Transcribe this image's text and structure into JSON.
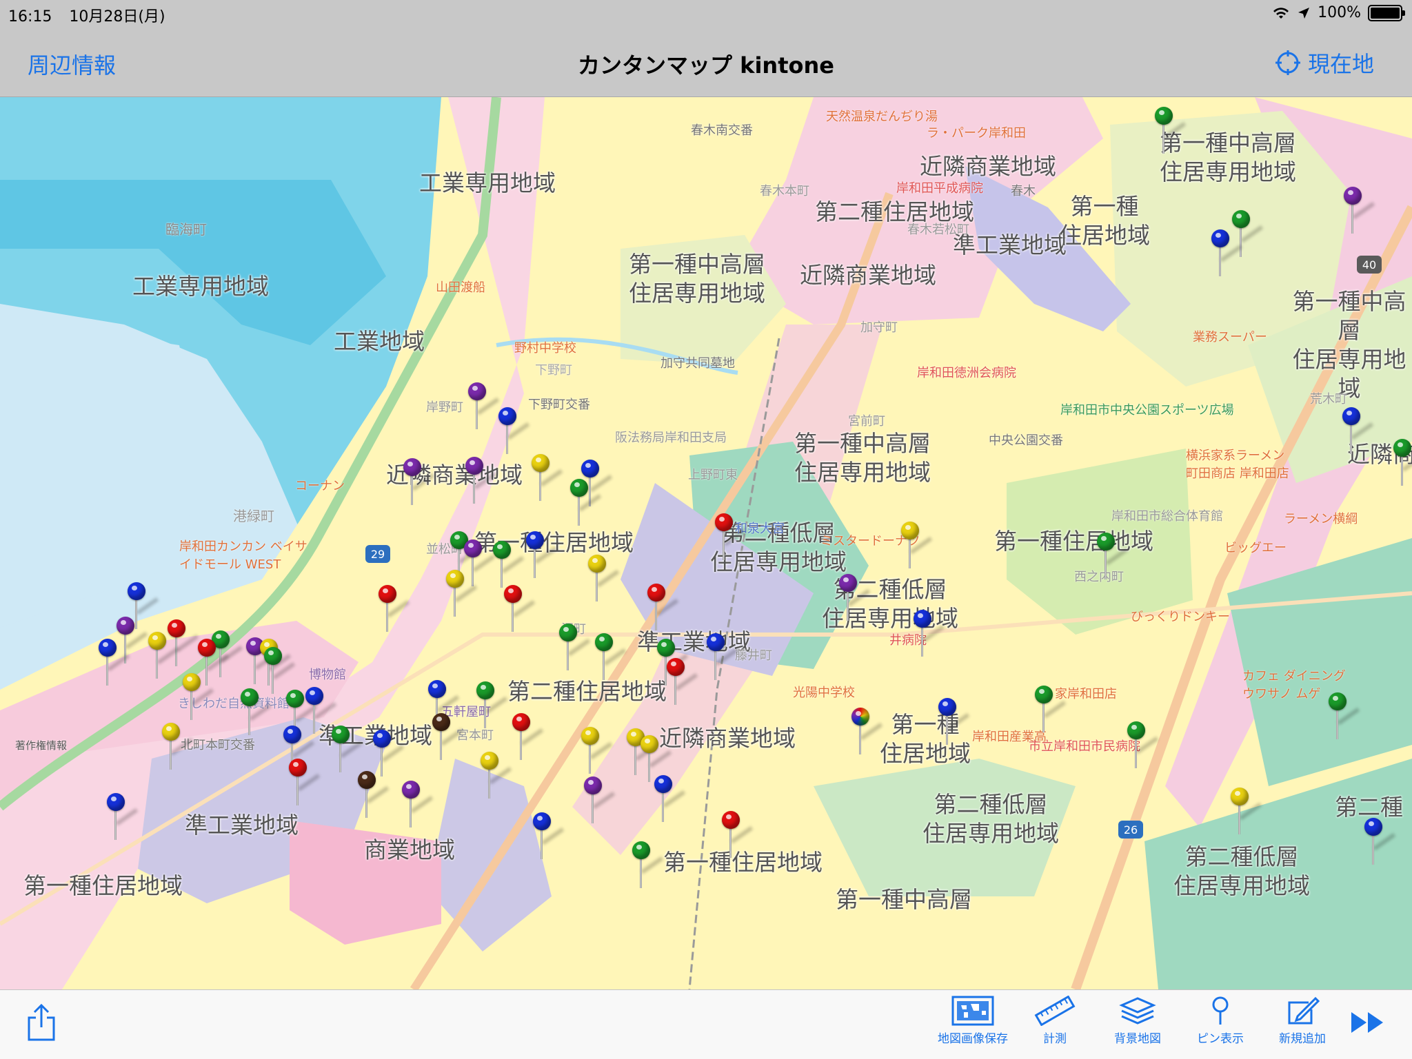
{
  "status_bar": {
    "time": "16:15",
    "date": "10月28日(月)",
    "battery": "100%"
  },
  "nav": {
    "left_button": "周辺情報",
    "title": "カンタンマップ kintone",
    "right_button": "現在地",
    "right_icon": "crosshair-icon"
  },
  "map": {
    "zone_labels": [
      "工業専用地域",
      "工業専用地域",
      "工業地域",
      "近隣商業地域",
      "第二種住居地域",
      "第一種中高層\n住居専用地域",
      "近隣商業地域",
      "準工業地域",
      "第一種\n住居地域",
      "第一種中高層\n住居専用地域",
      "第一種中高層\n住居専用地域",
      "近隣商業地域",
      "第一種住居地域",
      "第二種低層\n住居専用地域",
      "第一種中高層\n住居専用地域",
      "第一種住居地域",
      "近隣商業地域",
      "準工業地域",
      "第二種住居地域",
      "準工業地域",
      "近隣商業地域",
      "第一種\n住居地域",
      "準工業地域",
      "商業地域",
      "第一種住居地域",
      "第二種低層\n住居専用地域",
      "第一種住居地域",
      "第一種中高層",
      "第二種低層\n住居専用地域",
      "第二種低層\n住居専用地域",
      "第二種"
    ],
    "pois": [
      "天然温泉だんぢり湯",
      "ラ・パーク岸和田",
      "春木南交番",
      "春木本町",
      "岸和田平成病院",
      "春木",
      "春木若松町",
      "臨海町",
      "山田渡船",
      "野村中学校",
      "下野町",
      "加守町",
      "加守共同墓地",
      "岸和田徳洲会病院",
      "業務スーパー",
      "荒木町",
      "岸野町",
      "下野町交番",
      "阪法務局岸和田支局",
      "宮前町",
      "中央公園交番",
      "岸和田市中央公園スポーツ広場",
      "横浜家系ラーメン\n町田商店 岸和田店",
      "コーナン",
      "港緑町",
      "上野町東",
      "和泉大宮",
      "岸和田市総合体育館",
      "ラーメン横綱",
      "岸和田カンカン ベイサイドモール WEST",
      "並松町",
      "ミスタードーナツ",
      "西之内町",
      "ビッグエー",
      "びっくりドンキー",
      "沼町",
      "藤井町",
      "井病院",
      "カフェ ダイニング\nウワサノ ムゲ",
      "家岸和田店",
      "光陽中学校",
      "岸和田産業高",
      "きしわだ自然資料館",
      "宮本町",
      "市立岸和田市民病院",
      "著作権情報",
      "北町本町交番",
      "博物館",
      "五軒屋町"
    ]
  },
  "pins": {
    "colors": {
      "red": "#e01010",
      "blue": "#1530d8",
      "green": "#1a9a2a",
      "yellow": "#e8d010",
      "purple": "#7a2aaa",
      "brown": "#4a2a18"
    }
  },
  "toolbar": {
    "share_icon": "share-icon",
    "buttons": [
      {
        "label": "地図画像保存",
        "icon": "map-save-icon"
      },
      {
        "label": "計測",
        "icon": "ruler-icon"
      },
      {
        "label": "背景地図",
        "icon": "layers-icon"
      },
      {
        "label": "ピン表示",
        "icon": "pin-icon"
      },
      {
        "label": "新規追加",
        "icon": "compose-icon"
      }
    ],
    "forward_icon": "fast-forward-icon"
  },
  "road_numbers": [
    "29",
    "40",
    "26"
  ]
}
